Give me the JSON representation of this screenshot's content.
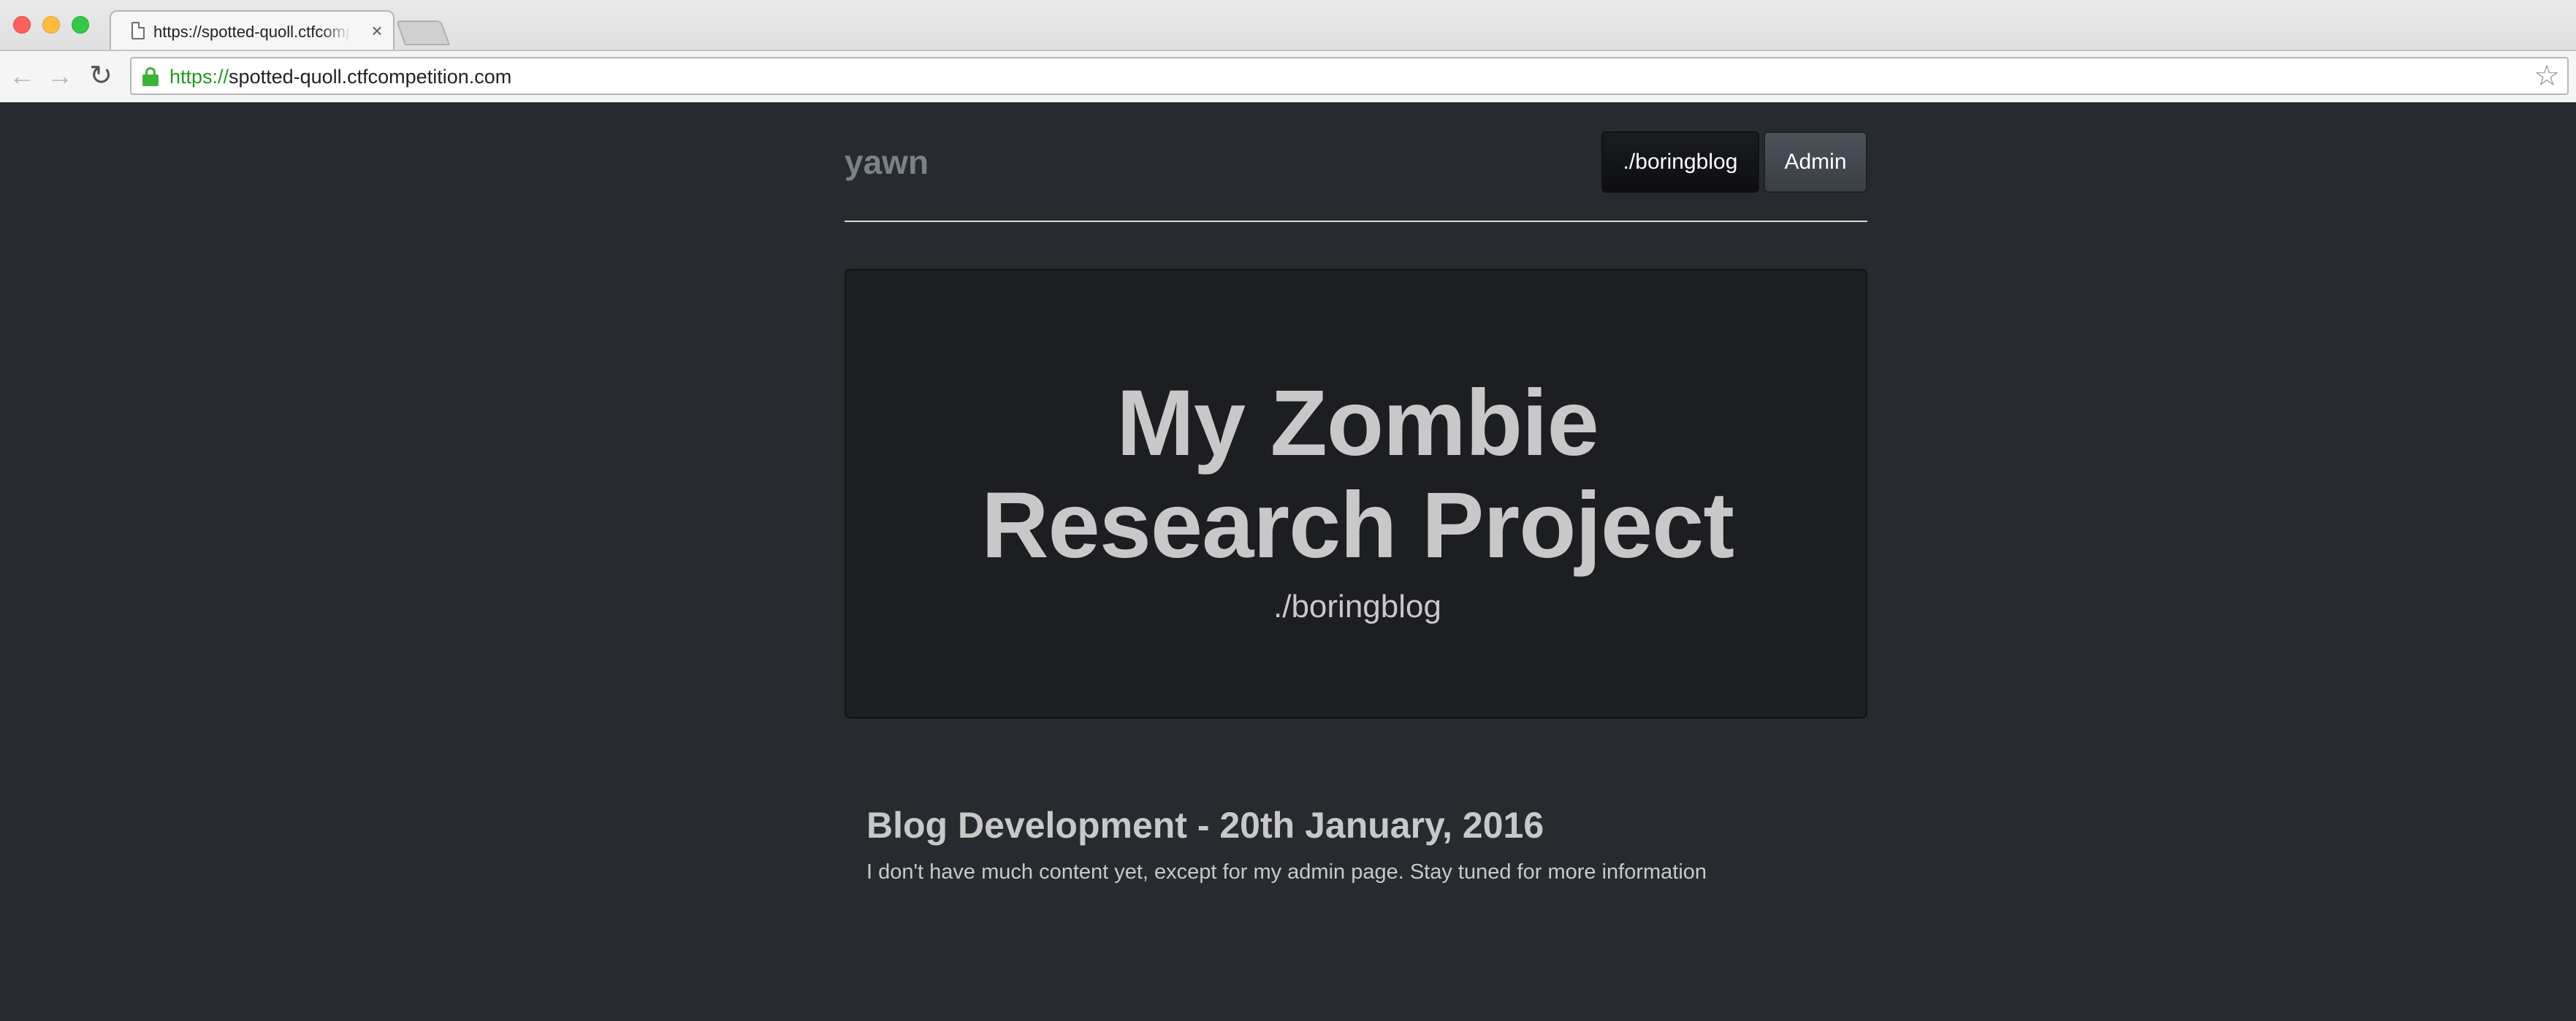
{
  "browser": {
    "tab_title": "https://spotted-quoll.ctfcompetition.com",
    "tab_close": "×",
    "url_scheme": "https://",
    "url_host": "spotted-quoll.ctfcompetition.com",
    "back_icon": "←",
    "forward_icon": "→",
    "reload_icon": "↻",
    "bookmark_icon": "☆"
  },
  "site": {
    "brand": "yawn",
    "nav": {
      "active_label": "./boringblog",
      "admin_label": "Admin"
    }
  },
  "hero": {
    "title_line1": "My Zombie",
    "title_line2": "Research Project",
    "subtitle": "./boringblog"
  },
  "post": {
    "title": "Blog Development - 20th January, 2016",
    "body": "I don't have much content yet, except for my admin page. Stay tuned for more information"
  },
  "colors": {
    "page_background": "#272b30",
    "jumbotron_background": "#1c1e22",
    "text": "#c8c8c8",
    "brand": "#7a8288",
    "https_green": "#1e9a1e"
  }
}
